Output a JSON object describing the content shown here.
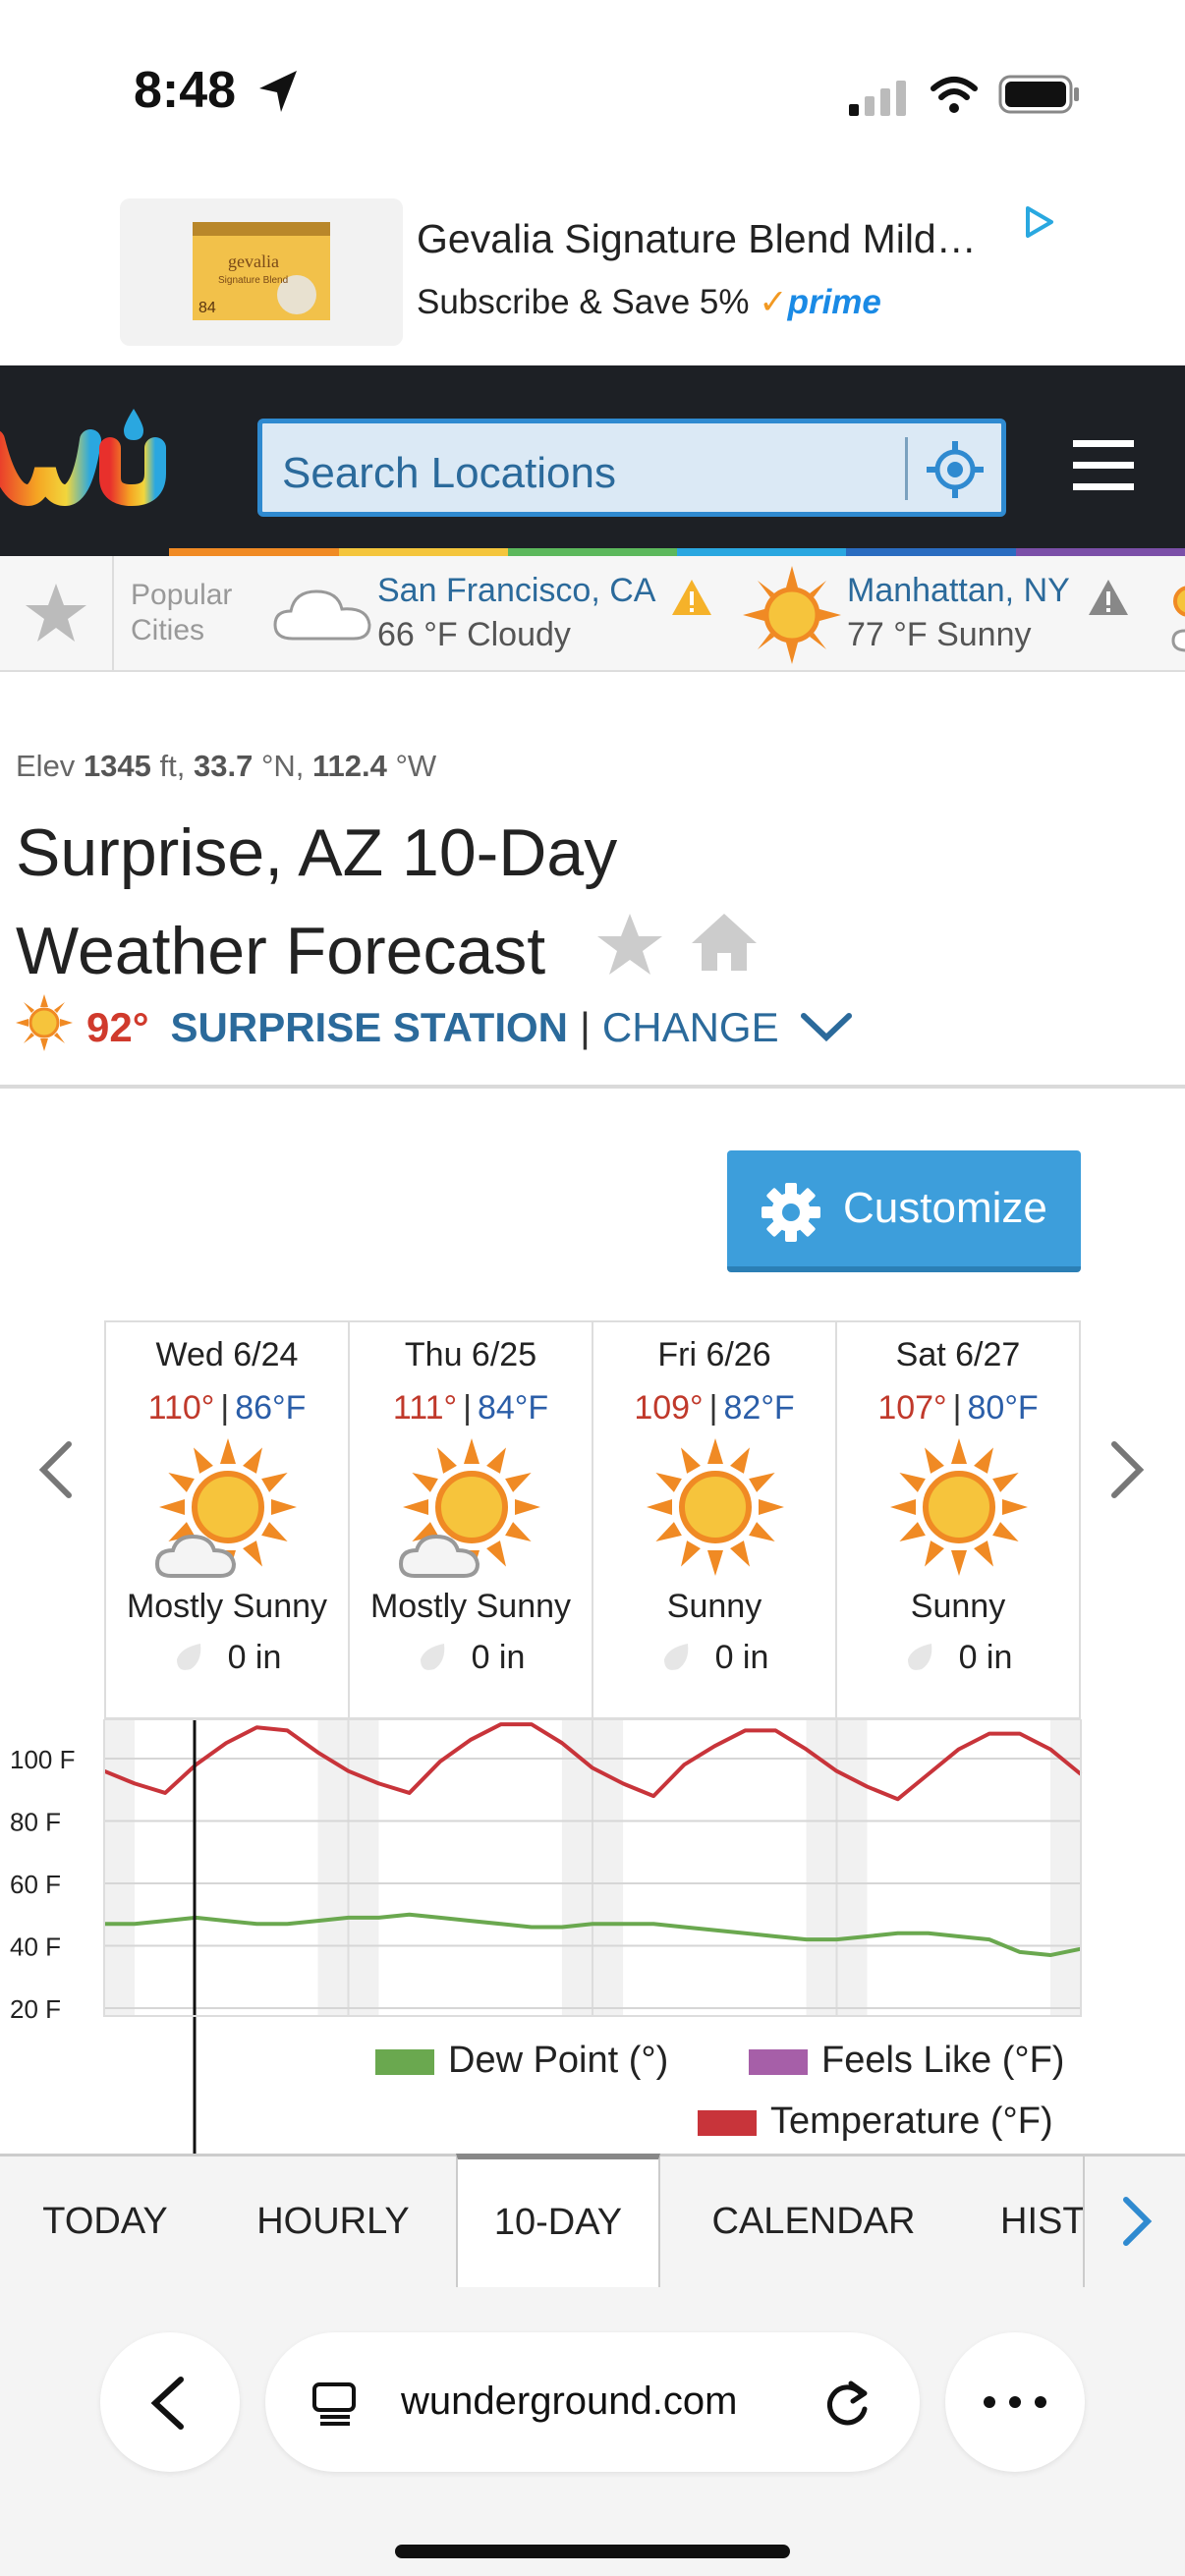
{
  "status_bar": {
    "time": "8:48"
  },
  "ad": {
    "title": "Gevalia Signature Blend Mild…",
    "subtitle": "Subscribe & Save 5%",
    "prime": "prime",
    "package_brand": "gevalia",
    "package_sub": "Signature Blend",
    "package_count": "84"
  },
  "header": {
    "search_placeholder": "Search Locations"
  },
  "popular": {
    "label_line1": "Popular",
    "label_line2": "Cities",
    "cities": [
      {
        "name": "San Francisco, CA",
        "conditions": "66 °F Cloudy"
      },
      {
        "name": "Manhattan, NY",
        "conditions": "77 °F Sunny"
      }
    ]
  },
  "location": {
    "elev_label": "Elev",
    "elev_value": "1345",
    "elev_unit": "ft,",
    "lat_value": "33.7",
    "lat_unit": "°N,",
    "lon_value": "112.4",
    "lon_unit": "°W",
    "title_line1": "Surprise, AZ 10-Day",
    "title_line2": "Weather Forecast",
    "current_temp": "92°",
    "station": "SURPRISE STATION",
    "separator": "|",
    "change": "CHANGE"
  },
  "customize": {
    "label": "Customize"
  },
  "forecast": [
    {
      "date": "Wed 6/24",
      "high": "110°",
      "low": "86",
      "unit": "°F",
      "condition": "Mostly Sunny",
      "precip": "0 in",
      "icon": "sun-cloud-icon"
    },
    {
      "date": "Thu 6/25",
      "high": "111°",
      "low": "84",
      "unit": "°F",
      "condition": "Mostly Sunny",
      "precip": "0 in",
      "icon": "sun-cloud-icon"
    },
    {
      "date": "Fri 6/26",
      "high": "109°",
      "low": "82",
      "unit": "°F",
      "condition": "Sunny",
      "precip": "0 in",
      "icon": "sun-icon"
    },
    {
      "date": "Sat 6/27",
      "high": "107°",
      "low": "80",
      "unit": "°F",
      "condition": "Sunny",
      "precip": "0 in",
      "icon": "sun-icon"
    }
  ],
  "chart_data": {
    "type": "line",
    "y_ticks": [
      "100 F",
      "80 F",
      "60 F",
      "40 F",
      "20 F"
    ],
    "ylim": [
      20,
      100
    ],
    "x": [
      0,
      3,
      6,
      9,
      12,
      15,
      18,
      21,
      24,
      27,
      30,
      33,
      36,
      39,
      42,
      45,
      48,
      51,
      54,
      57,
      60,
      63,
      66,
      69,
      72,
      75,
      78,
      81,
      84,
      87,
      90,
      93,
      96
    ],
    "series": [
      {
        "name": "Temperature (°F)",
        "color": "#c8343a",
        "values": [
          96,
          92,
          89,
          98,
          105,
          110,
          109,
          102,
          96,
          92,
          89,
          99,
          106,
          111,
          111,
          105,
          97,
          92,
          88,
          98,
          104,
          109,
          109,
          103,
          96,
          91,
          87,
          95,
          103,
          108,
          108,
          103,
          95
        ]
      },
      {
        "name": "Dew Point (°)",
        "color": "#6aa84f",
        "values": [
          47,
          47,
          48,
          49,
          48,
          47,
          47,
          48,
          49,
          49,
          50,
          49,
          48,
          47,
          46,
          46,
          47,
          47,
          47,
          46,
          45,
          44,
          43,
          42,
          42,
          43,
          44,
          44,
          43,
          42,
          38,
          37,
          39
        ]
      }
    ],
    "legend": [
      {
        "label": "Dew Point (°)",
        "color": "#6aa84f"
      },
      {
        "label": "Feels Like (°F)",
        "color": "#a65fa8"
      },
      {
        "label": "Temperature (°F)",
        "color": "#c8343a"
      }
    ]
  },
  "tabs": [
    {
      "label": "TODAY"
    },
    {
      "label": "HOURLY"
    },
    {
      "label": "10-DAY"
    },
    {
      "label": "CALENDAR"
    },
    {
      "label": "HIST"
    }
  ],
  "browser": {
    "url": "wunderground.com"
  }
}
